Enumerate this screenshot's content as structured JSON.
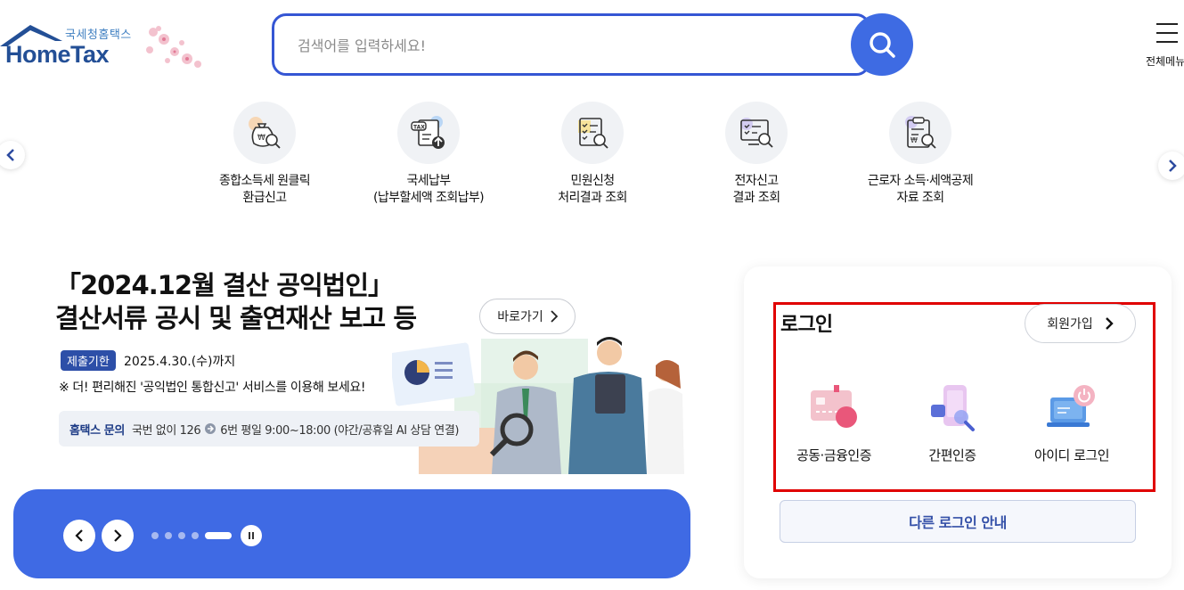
{
  "header": {
    "logo_sub": "국세청홈택스",
    "logo_main": "HomeTax",
    "search_placeholder": "검색어를 입력하세요!",
    "all_menu_label": "전체메뉴"
  },
  "quick_menu": [
    {
      "label": "종합소득세 원클릭\n환급신고",
      "icon": "money-bag-search-icon"
    },
    {
      "label": "국세납부\n(납부할세액 조회납부)",
      "icon": "tax-document-upload-icon"
    },
    {
      "label": "민원신청\n처리결과 조회",
      "icon": "document-search-icon"
    },
    {
      "label": "전자신고\n결과 조회",
      "icon": "monitor-search-icon"
    },
    {
      "label": "근로자 소득·세액공제\n자료 조회",
      "icon": "clipboard-search-icon"
    }
  ],
  "banner": {
    "title": "「2024.12월 결산 공익법인」\n결산서류 공시 및 출연재산 보고 등",
    "go_label": "바로가기",
    "deadline_badge": "제출기한",
    "deadline_text": "2025.4.30.(수)까지",
    "note": "※ 더! 편리해진 '공익법인 통합신고' 서비스를 이용해 보세요!",
    "contact_label": "홈택스 문의",
    "contact_text_1": "국번 없이 126",
    "contact_text_2": "6번 평일 9:00~18:00 (야간/공휴일 AI 상담 연결)",
    "slide_count": 5,
    "active_slide": 5
  },
  "login": {
    "title": "로그인",
    "signup_label": "회원가입",
    "options": [
      {
        "label": "공동·금융인증",
        "icon": "certificate-card-icon"
      },
      {
        "label": "간편인증",
        "icon": "phone-search-icon"
      },
      {
        "label": "아이디 로그인",
        "icon": "laptop-power-icon"
      }
    ],
    "other_login_label": "다른 로그인 안내"
  },
  "colors": {
    "primary": "#3e6be3",
    "navy": "#234f96",
    "highlight": "#e00000"
  }
}
